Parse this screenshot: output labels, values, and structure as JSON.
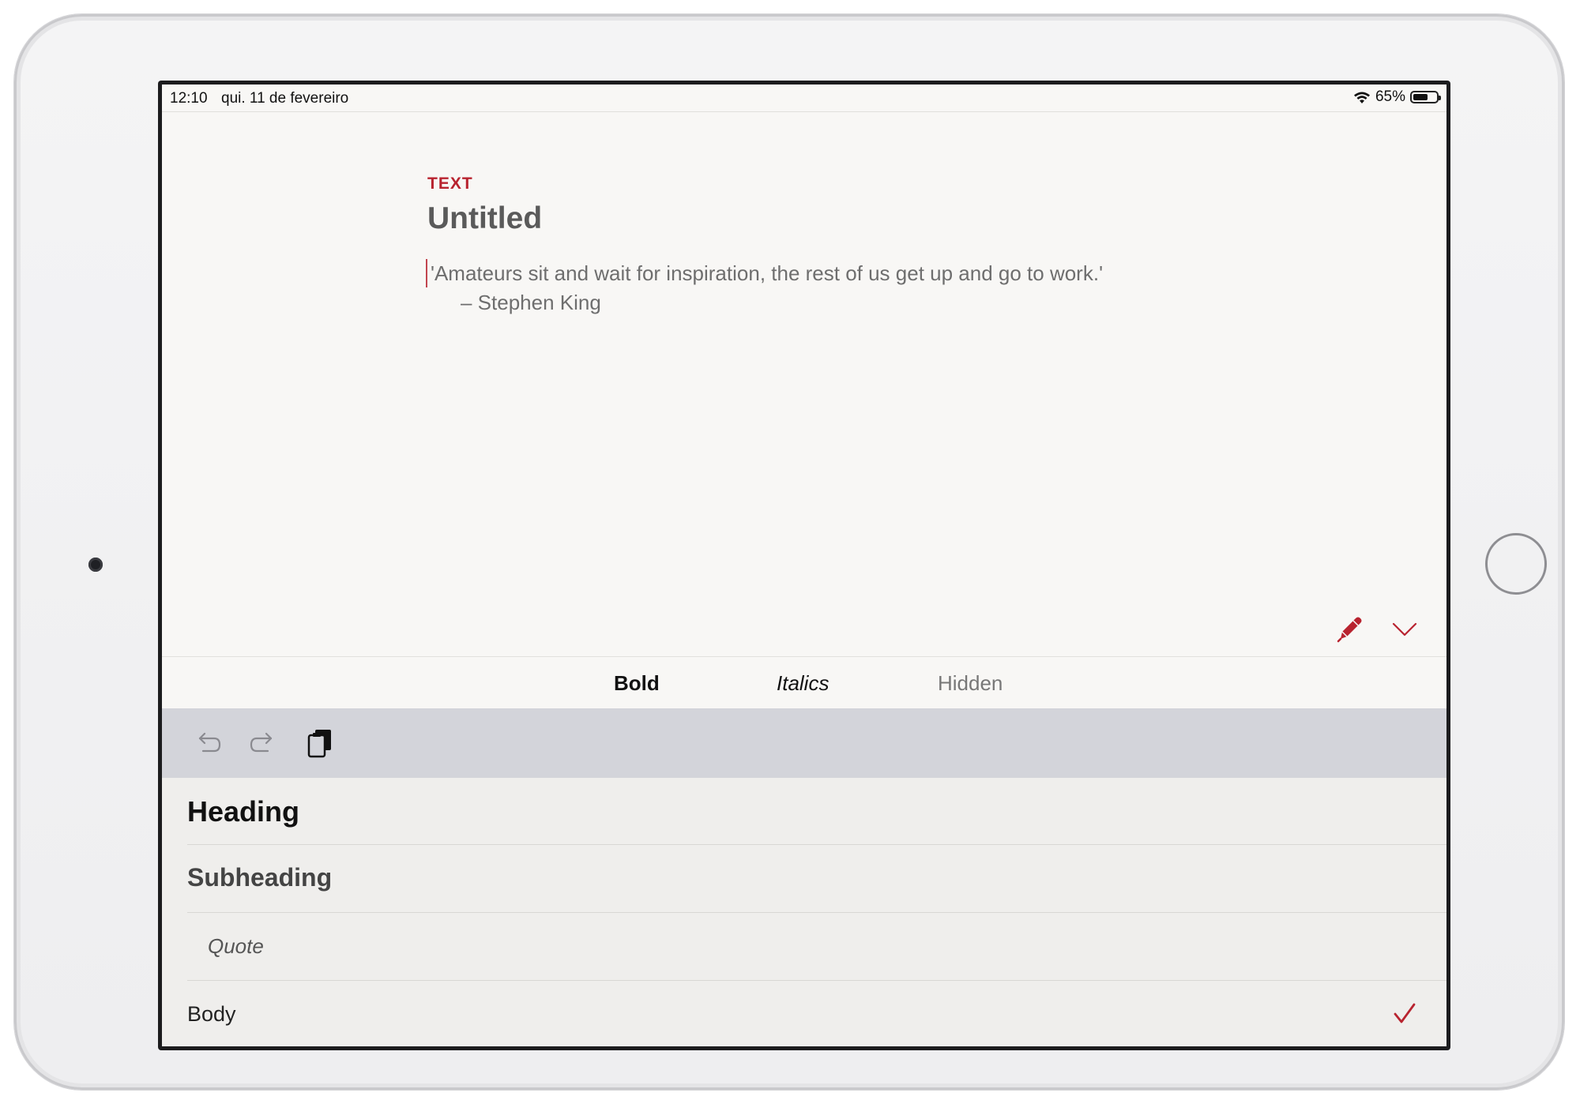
{
  "status_bar": {
    "time": "12:10",
    "date": "qui. 11 de fevereiro",
    "battery_percent": "65%",
    "battery_level": 0.65
  },
  "document": {
    "label": "TEXT",
    "title": "Untitled",
    "quote_line": "'Amateurs sit and wait for inspiration, the rest of us get up and go to work.'",
    "quote_author": "– Stephen King"
  },
  "format_bar": {
    "bold": "Bold",
    "italics": "Italics",
    "hidden": "Hidden"
  },
  "toolbar": {
    "icons": [
      "undo-icon",
      "redo-icon",
      "paste-icon"
    ]
  },
  "styles": [
    {
      "label": "Heading",
      "selected": false
    },
    {
      "label": "Subheading",
      "selected": false
    },
    {
      "label": "Quote",
      "selected": false
    },
    {
      "label": "Body",
      "selected": true
    }
  ],
  "colors": {
    "accent": "#b8232f",
    "background": "#f8f7f5",
    "toolbar": "#d3d4da",
    "style_list": "#efeeec"
  }
}
